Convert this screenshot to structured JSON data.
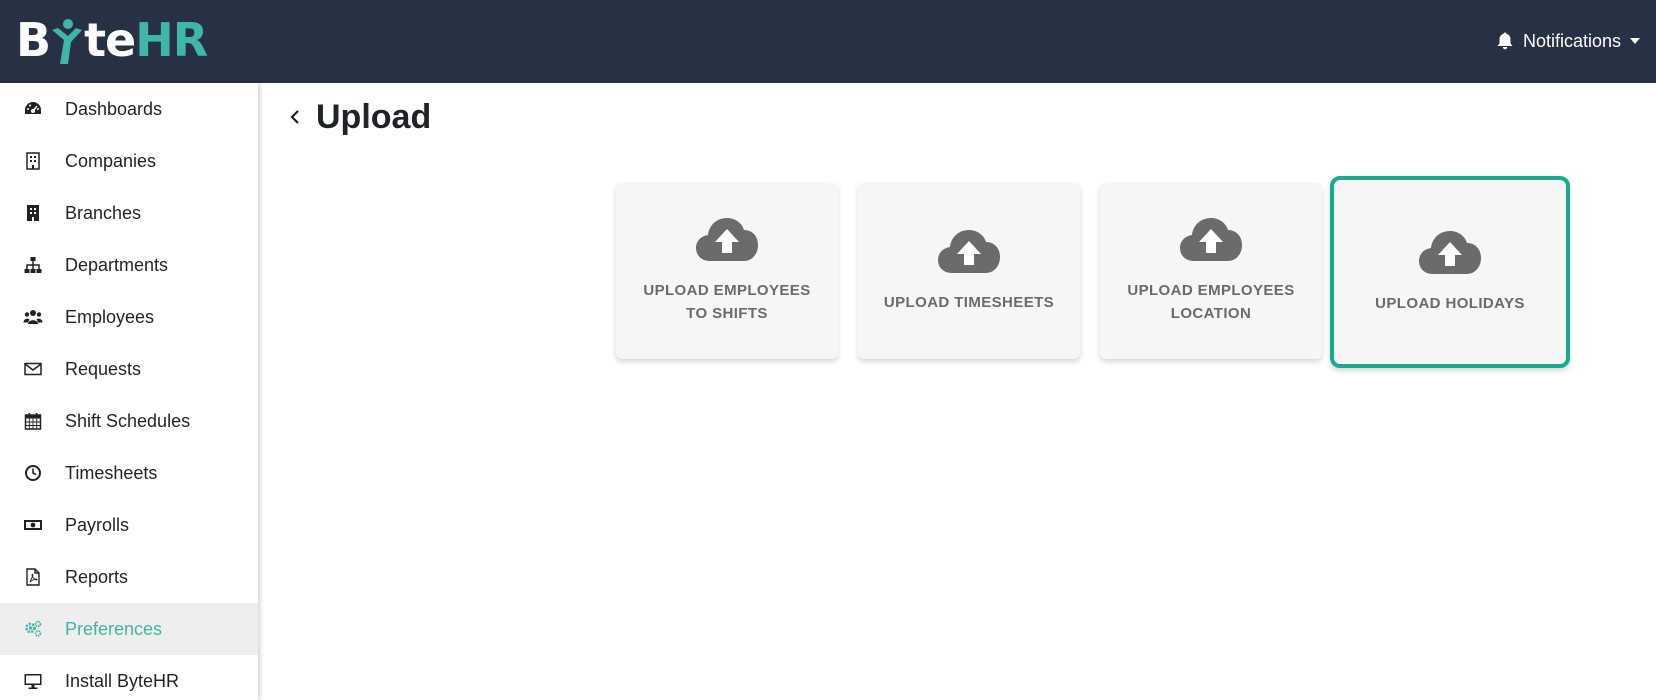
{
  "brand": {
    "logo_prefix": "B",
    "logo_mid": "te",
    "logo_suffix": "HR"
  },
  "header": {
    "notifications_label": "Notifications"
  },
  "sidebar": {
    "items": [
      {
        "label": "Dashboards",
        "icon": "dashboard-icon"
      },
      {
        "label": "Companies",
        "icon": "building-outline-icon"
      },
      {
        "label": "Branches",
        "icon": "building-icon"
      },
      {
        "label": "Departments",
        "icon": "org-chart-icon"
      },
      {
        "label": "Employees",
        "icon": "users-icon"
      },
      {
        "label": "Requests",
        "icon": "envelope-icon"
      },
      {
        "label": "Shift Schedules",
        "icon": "calendar-icon"
      },
      {
        "label": "Timesheets",
        "icon": "clock-icon"
      },
      {
        "label": "Payrolls",
        "icon": "money-icon"
      },
      {
        "label": "Reports",
        "icon": "pdf-file-icon"
      },
      {
        "label": "Preferences",
        "icon": "cogs-icon",
        "active": true
      },
      {
        "label": "Install ByteHR",
        "icon": "desktop-icon"
      }
    ]
  },
  "main": {
    "title": "Upload",
    "cards": [
      {
        "label": "UPLOAD EMPLOYEES TO SHIFTS",
        "icon": "cloud-upload-icon"
      },
      {
        "label": "UPLOAD TIMESHEETS",
        "icon": "cloud-upload-icon"
      },
      {
        "label": "UPLOAD EMPLOYEES LOCATION",
        "icon": "cloud-upload-icon"
      },
      {
        "label": "UPLOAD HOLIDAYS",
        "icon": "cloud-upload-icon",
        "selected": true
      }
    ]
  },
  "colors": {
    "topbar": "#263244",
    "accent": "#3fb6a8",
    "selected_border": "#18a98e",
    "card_bg": "#f6f6f6",
    "card_text": "#6a6a6a"
  }
}
